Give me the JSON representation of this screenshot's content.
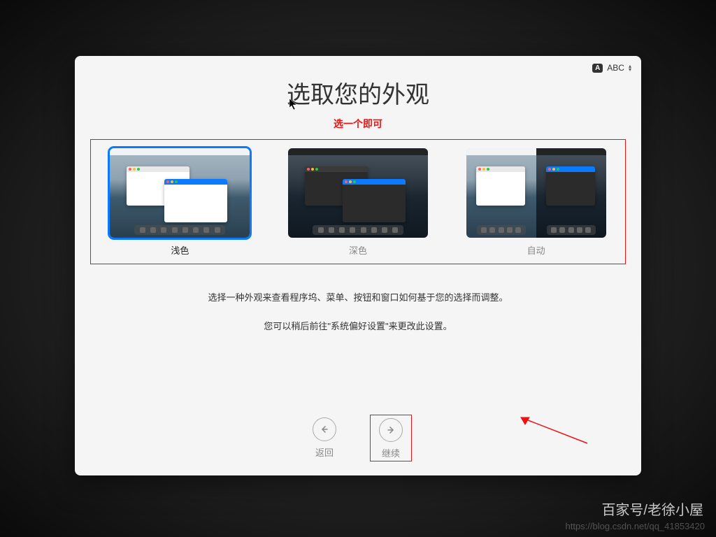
{
  "ime": {
    "badge": "A",
    "label": "ABC"
  },
  "title": "选取您的外观",
  "annotation_subtitle": "选一个即可",
  "options": [
    {
      "label": "浅色",
      "selected": true
    },
    {
      "label": "深色",
      "selected": false
    },
    {
      "label": "自动",
      "selected": false
    }
  ],
  "description": {
    "line1": "选择一种外观来查看程序坞、菜单、按钮和窗口如何基于您的选择而调整。",
    "line2": "您可以稍后前往\"系统偏好设置\"来更改此设置。"
  },
  "nav": {
    "back": "返回",
    "continue": "继续"
  },
  "footer": {
    "credit": "百家号/老徐小屋",
    "watermark": "https://blog.csdn.net/qq_41853420"
  }
}
